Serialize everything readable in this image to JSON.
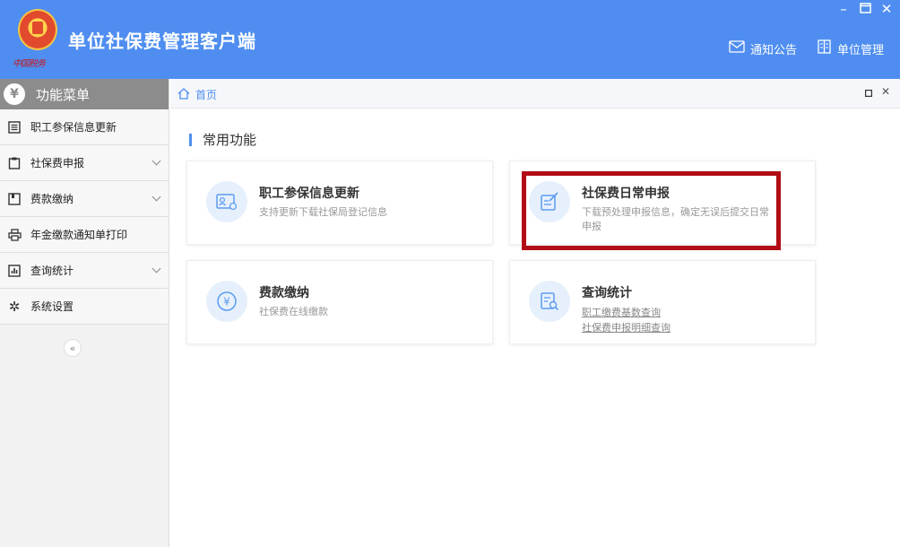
{
  "header": {
    "logo_text": "中国税务",
    "app_title": "单位社保费管理客户端",
    "links": [
      {
        "label": "通知公告",
        "icon": "mail-icon"
      },
      {
        "label": "单位管理",
        "icon": "building-icon"
      }
    ],
    "window_controls": [
      "minimize",
      "maximize",
      "close"
    ]
  },
  "sidebar": {
    "title": "功能菜单",
    "items": [
      {
        "label": "职工参保信息更新",
        "icon": "list-icon",
        "expandable": false
      },
      {
        "label": "社保费申报",
        "icon": "clipboard-icon",
        "expandable": true
      },
      {
        "label": "费款缴纳",
        "icon": "wallet-icon",
        "expandable": true
      },
      {
        "label": "年金缴款通知单打印",
        "icon": "printer-icon",
        "expandable": false
      },
      {
        "label": "查询统计",
        "icon": "bar-chart-icon",
        "expandable": true
      },
      {
        "label": "系统设置",
        "icon": "gear-icon",
        "expandable": false
      }
    ],
    "collapse_symbol": "«"
  },
  "tabs": [
    {
      "label": "首页",
      "icon": "home-icon"
    }
  ],
  "main": {
    "section_title": "常用功能",
    "cards": [
      {
        "title": "职工参保信息更新",
        "desc": "支持更新下载社保局登记信息",
        "icon": "id-card-icon"
      },
      {
        "title": "社保费日常申报",
        "desc": "下载预处理申报信息，确定无误后提交日常申报",
        "icon": "edit-doc-icon",
        "highlighted": true
      },
      {
        "title": "费款缴纳",
        "desc": "社保费在线缴款",
        "icon": "yen-icon"
      },
      {
        "title": "查询统计",
        "links": [
          "职工缴费基数查询",
          "社保费申报明细查询"
        ],
        "icon": "doc-search-icon"
      }
    ]
  },
  "colors": {
    "header_bg": "#4f8ef0",
    "accent": "#4f8ef0",
    "highlight_border": "#b20d16",
    "sidebar_head": "#8c8c8c"
  }
}
